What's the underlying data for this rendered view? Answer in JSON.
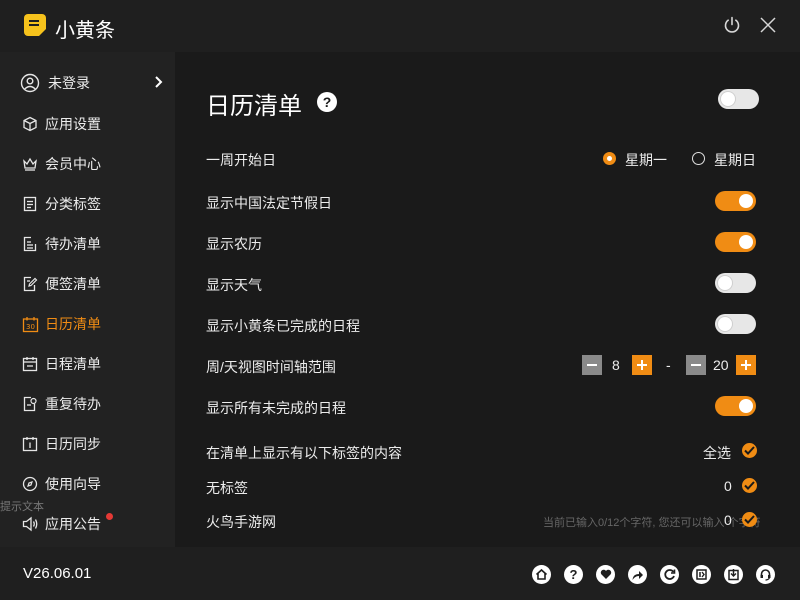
{
  "app": {
    "title": "小黄条",
    "icons": {
      "logo": "sticky-note-icon",
      "power": "power-icon",
      "close": "close-icon"
    }
  },
  "sidebar": {
    "user_label": "未登录",
    "items": [
      {
        "label": "应用设置",
        "icon": "cube-icon",
        "active": false
      },
      {
        "label": "会员中心",
        "icon": "crown-icon",
        "active": false
      },
      {
        "label": "分类标签",
        "icon": "tag-list-icon",
        "active": false
      },
      {
        "label": "待办清单",
        "icon": "todo-list-icon",
        "active": false
      },
      {
        "label": "便签清单",
        "icon": "note-edit-icon",
        "active": false
      },
      {
        "label": "日历清单",
        "icon": "calendar-30-icon",
        "active": true
      },
      {
        "label": "日程清单",
        "icon": "schedule-icon",
        "active": false
      },
      {
        "label": "重复待办",
        "icon": "repeat-icon",
        "active": false
      },
      {
        "label": "日历同步",
        "icon": "calendar-sync-icon",
        "active": false
      },
      {
        "label": "使用向导",
        "icon": "guide-icon",
        "active": false
      },
      {
        "label": "应用公告",
        "icon": "speaker-icon",
        "active": false
      }
    ],
    "ghost_text": "提示文本"
  },
  "main": {
    "title": "日历清单",
    "master_toggle_on": false,
    "week_start": {
      "label": "一周开始日",
      "options": [
        "星期一",
        "星期日"
      ],
      "selected": "星期一"
    },
    "settings": [
      {
        "label": "显示中国法定节假日",
        "on": true
      },
      {
        "label": "显示农历",
        "on": true
      },
      {
        "label": "显示天气",
        "on": false
      },
      {
        "label": "显示小黄条已完成的日程",
        "on": false
      }
    ],
    "time_range": {
      "label": "周/天视图时间轴范围",
      "start": "8",
      "separator": "-",
      "end": "20"
    },
    "show_incomplete": {
      "label": "显示所有未完成的日程",
      "on": true
    },
    "tags_section": {
      "label": "在清单上显示有以下标签的内容",
      "select_all": "全选",
      "tags": [
        {
          "label": "无标签",
          "count": "0"
        },
        {
          "label": "火鸟手游网",
          "count": "0"
        }
      ]
    },
    "ghost_text": "当前已输入0/12个字符, 您还可以输入 个字符"
  },
  "footer": {
    "version": "V26.06.01",
    "icons": [
      "home-icon",
      "help-icon",
      "heart-icon",
      "share-icon",
      "refresh-icon",
      "export-icon",
      "import-icon",
      "support-icon"
    ]
  }
}
